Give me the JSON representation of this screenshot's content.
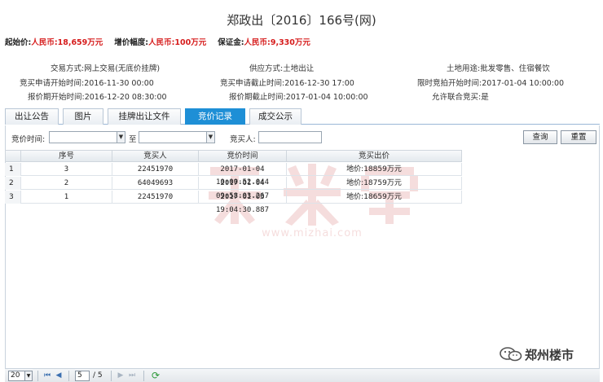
{
  "title": "郑政出〔2016〕166号(网)",
  "price_bar": {
    "start_label": "起始价:",
    "start_value": "人民币:18,659万元",
    "increment_label": "增价幅度:",
    "increment_value": "人民币:100万元",
    "deposit_label": "保证金:",
    "deposit_value": "人民币:9,330万元"
  },
  "info": {
    "trade_mode_label": "交易方式:",
    "trade_mode_value": "网上交易(无底价挂牌)",
    "supply_mode_label": "供应方式:",
    "supply_mode_value": "土地出让",
    "land_use_label": "土地用途:",
    "land_use_value": "批发零售、住宿餐饮",
    "apply_start_label": "竞买申请开始时间:",
    "apply_start_value": "2016-11-30 00:00",
    "apply_end_label": "竞买申请截止时间:",
    "apply_end_value": "2016-12-30 17:00",
    "auction_start_label": "限时竞拍开始时间:",
    "auction_start_value": "2017-01-04 10:00:00",
    "quote_start_label": "报价期开始时间:",
    "quote_start_value": "2016-12-20 08:30:00",
    "quote_end_label": "报价期截止时间:",
    "quote_end_value": "2017-01-04 10:00:00",
    "joint_bid_label": "允许联合竞买:",
    "joint_bid_value": "是"
  },
  "tabs": [
    {
      "label": "出让公告",
      "active": false
    },
    {
      "label": "图片",
      "active": false
    },
    {
      "label": "挂牌出让文件",
      "active": false
    },
    {
      "label": "竞价记录",
      "active": true
    },
    {
      "label": "成交公示",
      "active": false
    }
  ],
  "search": {
    "bid_time_label": "竞价时间:",
    "to_label": "至",
    "bidder_label": "竞买人:",
    "query_button": "查询",
    "reset_button": "重置"
  },
  "grid": {
    "headers": [
      "序号",
      "竞买人",
      "竞价时间",
      "竞买出价"
    ],
    "rows": [
      {
        "rownum": "1",
        "seq": "3",
        "bidder": "22451970",
        "time": "2017-01-04 10:00:52.044",
        "price": "地价:18859万元"
      },
      {
        "rownum": "2",
        "seq": "2",
        "bidder": "64049693",
        "time": "2017-01-04 09:58:03.267",
        "price": "地价:18759万元"
      },
      {
        "rownum": "3",
        "seq": "1",
        "bidder": "22451970",
        "time": "2017-01-03 19:04:30.887",
        "price": "地价:18659万元"
      }
    ]
  },
  "pager": {
    "page_size": "20",
    "current_page": "5",
    "total_pages": "/ 5"
  },
  "watermark": {
    "url": "www.mizhai.com"
  },
  "brand": {
    "name": "郑州楼市"
  },
  "colors": {
    "accent_red": "#d61c1c",
    "active_tab": "#1e8fd6"
  }
}
